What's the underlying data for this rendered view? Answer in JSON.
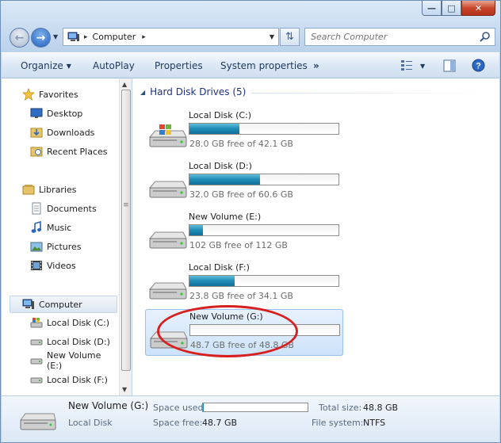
{
  "window": {
    "controls": {
      "minimize": "—",
      "maximize": "□",
      "close": "✕"
    }
  },
  "address": {
    "crumb": "Computer",
    "search_placeholder": "Search Computer"
  },
  "commands": {
    "organize": "Organize",
    "autoplay": "AutoPlay",
    "properties": "Properties",
    "system_properties": "System properties",
    "more": "»"
  },
  "sidebar": {
    "favorites": {
      "label": "Favorites",
      "items": [
        "Desktop",
        "Downloads",
        "Recent Places"
      ]
    },
    "libraries": {
      "label": "Libraries",
      "items": [
        "Documents",
        "Music",
        "Pictures",
        "Videos"
      ]
    },
    "computer": {
      "label": "Computer",
      "items": [
        "Local Disk (C:)",
        "Local Disk (D:)",
        "New Volume (E:)",
        "Local Disk (F:)"
      ]
    }
  },
  "main": {
    "group_title": "Hard Disk Drives (5)",
    "drives": [
      {
        "name": "Local Disk (C:)",
        "free": "28.0 GB free of 42.1 GB",
        "used_fraction": 0.335,
        "windows": true
      },
      {
        "name": "Local Disk (D:)",
        "free": "32.0 GB free of 60.6 GB",
        "used_fraction": 0.472
      },
      {
        "name": "New Volume (E:)",
        "free": "102 GB free of 112 GB",
        "used_fraction": 0.09
      },
      {
        "name": "Local Disk (F:)",
        "free": "23.8 GB free of 34.1 GB",
        "used_fraction": 0.302
      },
      {
        "name": "New Volume (G:)",
        "free": "48.7 GB free of 48.8 GB",
        "used_fraction": 0.002,
        "selected": true
      }
    ]
  },
  "details": {
    "name": "New Volume (G:)",
    "type": "Local Disk",
    "space_used_label": "Space used:",
    "space_free_label": "Space free:",
    "space_free": "48.7 GB",
    "total_size_label": "Total size:",
    "total_size": "48.8 GB",
    "file_system_label": "File system:",
    "file_system": "NTFS",
    "used_fraction": 0.002
  },
  "colors": {
    "bar_fill": "#1f8bb5",
    "group_title": "#1e3287",
    "annotation": "#d62020"
  }
}
